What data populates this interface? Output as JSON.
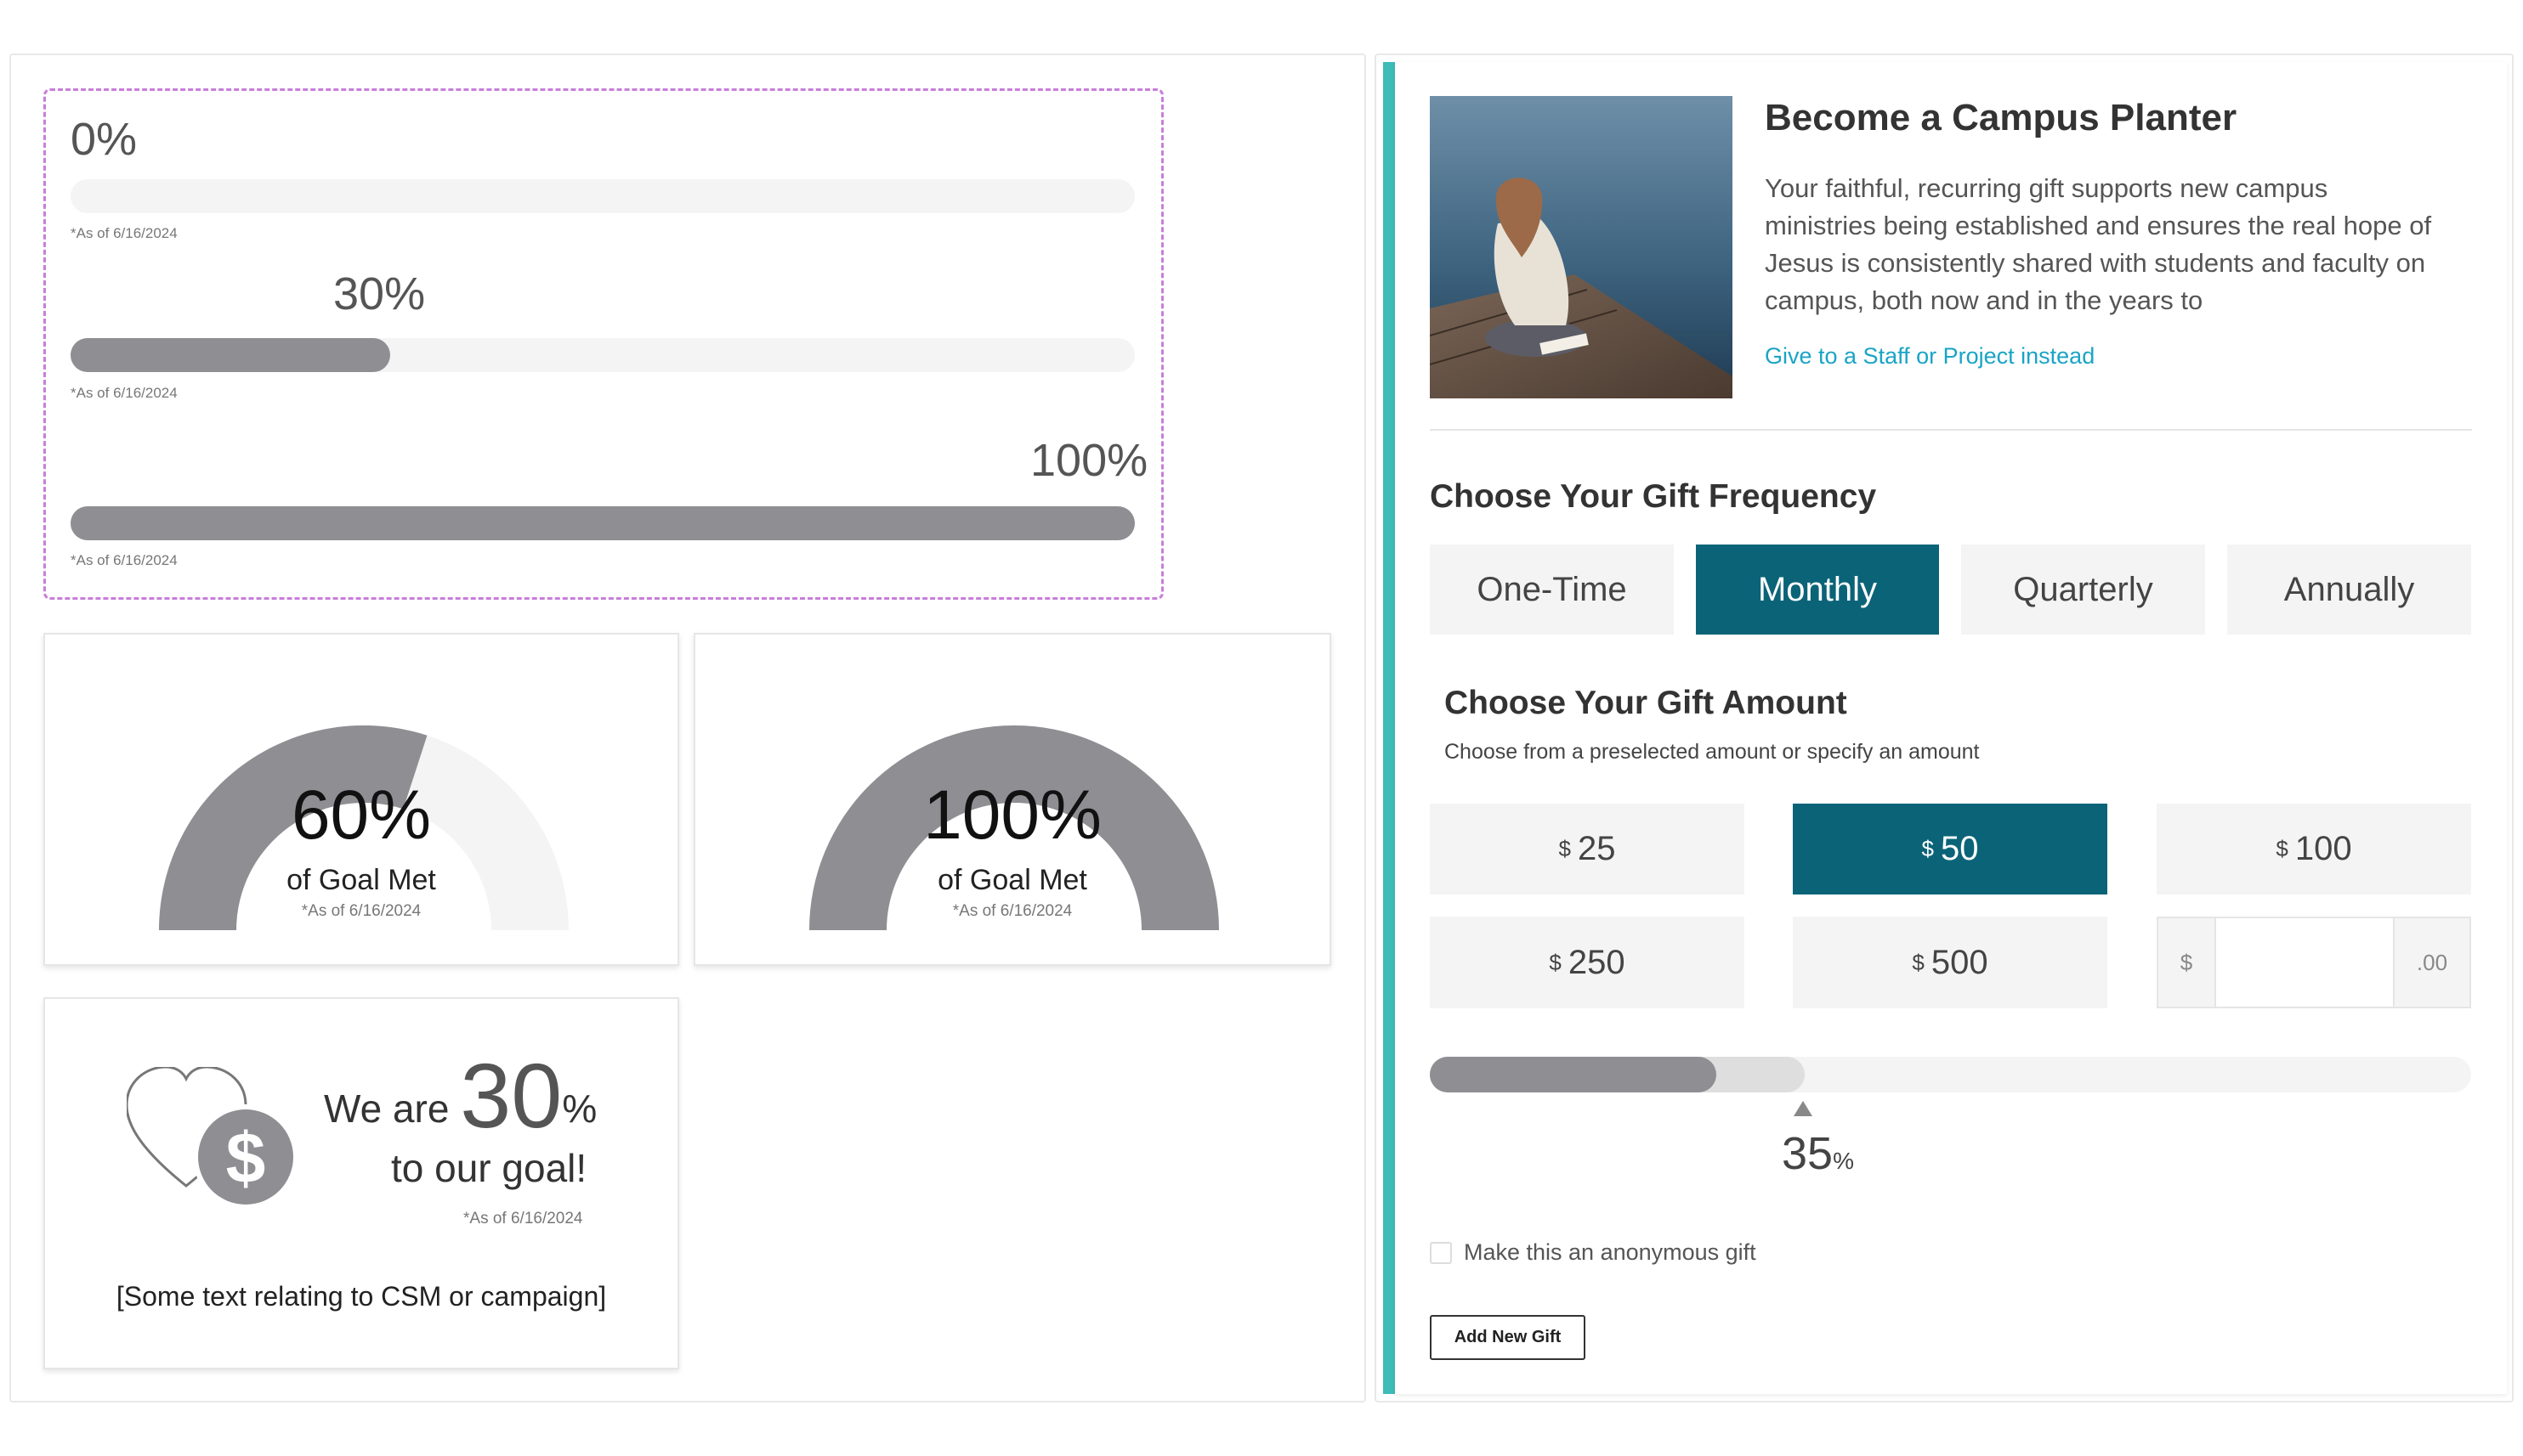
{
  "progress_bars": [
    {
      "label": "0%",
      "value": 0,
      "as_of": "*As of 6/16/2024"
    },
    {
      "label": "30%",
      "value": 30,
      "as_of": "*As of 6/16/2024"
    },
    {
      "label": "100%",
      "value": 100,
      "as_of": "*As of 6/16/2024"
    }
  ],
  "gauges": [
    {
      "value_label": "60%",
      "value": 60,
      "caption": "of Goal Met",
      "as_of": "*As of 6/16/2024"
    },
    {
      "value_label": "100%",
      "value": 100,
      "caption": "of Goal Met",
      "as_of": "*As of 6/16/2024"
    }
  ],
  "goal_card": {
    "text_before": "We are",
    "number": "30",
    "percent_sign": "%",
    "text_after": "to our goal!",
    "as_of": "*As of 6/16/2024",
    "caption": "[Some text relating to CSM or campaign]",
    "icon": "heart-dollar-icon"
  },
  "hero": {
    "title": "Become a Campus Planter",
    "body": "Your faithful, recurring gift supports new campus ministries being established and ensures the real hope of Jesus is consistently shared with students and faculty on campus, both now and in the years to",
    "link": "Give to a Staff or Project instead"
  },
  "frequency": {
    "title": "Choose Your Gift Frequency",
    "options": [
      "One-Time",
      "Monthly",
      "Quarterly",
      "Annually"
    ],
    "selected": "Monthly"
  },
  "amount": {
    "title": "Choose Your Gift Amount",
    "subtitle": "Choose from a preselected amount or specify an amount",
    "currency": "$",
    "options": [
      "25",
      "50",
      "100",
      "250",
      "500"
    ],
    "selected": "50",
    "custom_prefix": "$",
    "custom_suffix": ".00",
    "custom_value": ""
  },
  "progress": {
    "value": 35,
    "projected_value": 36,
    "value_label": "35",
    "unit": "%"
  },
  "anonymous_label": "Make this an anonymous gift",
  "add_gift_label": "Add New Gift",
  "colors": {
    "accent": "#3dbcb8",
    "primary": "#0b6378",
    "link": "#1aa4c6",
    "bar_fill": "#8e8e93",
    "bar_track": "#f4f4f4"
  }
}
